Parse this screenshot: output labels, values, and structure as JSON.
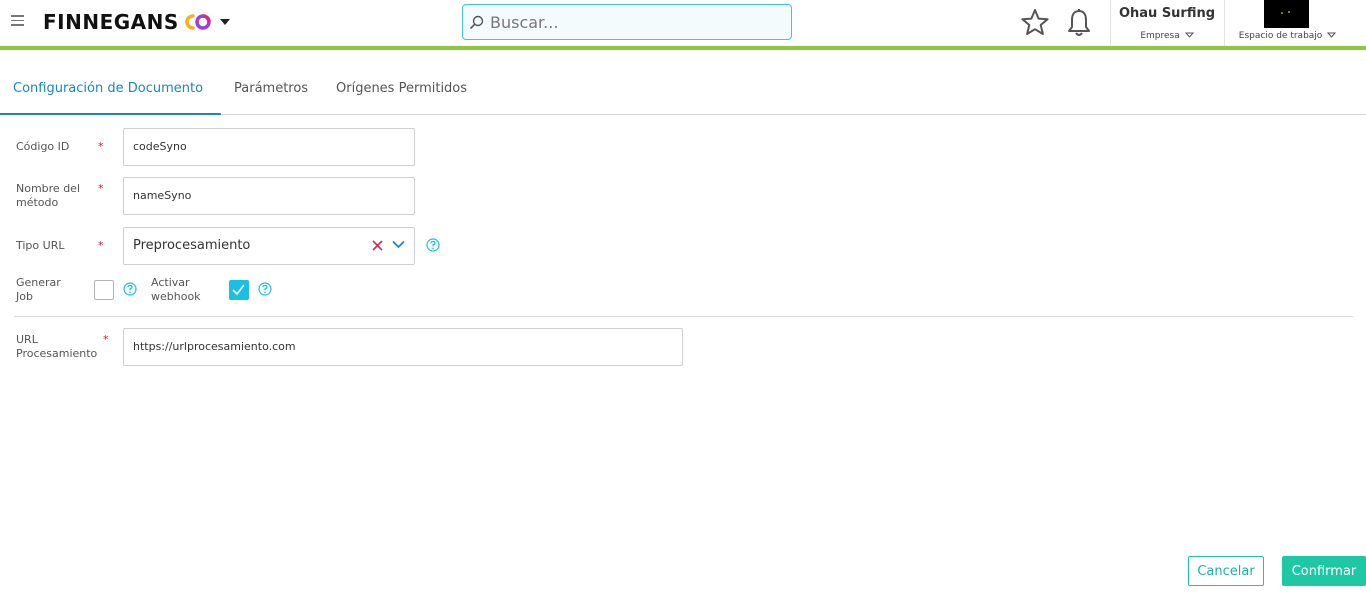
{
  "header": {
    "logo_text": "FINNEGANS",
    "search_placeholder": "Buscar...",
    "company_name": "Ohau Surfing",
    "company_label": "Empresa",
    "workspace_label": "Espacio de trabajo",
    "icons": [
      "menu-icon",
      "logo-mark-icon",
      "chevron-down-icon",
      "search-icon",
      "star-icon",
      "bell-icon"
    ],
    "colors": {
      "accent_line": "#8dc63f",
      "search_border": "#3fc7d6"
    }
  },
  "tabs": [
    {
      "label": "Configuración de Documento",
      "active": true
    },
    {
      "label": "Parámetros",
      "active": false
    },
    {
      "label": "Orígenes Permitidos",
      "active": false
    }
  ],
  "form": {
    "codigo_label": "Código ID",
    "codigo_value": "codeSyno",
    "nombre_label_1": "Nombre del",
    "nombre_label_2": "método",
    "nombre_value": "nameSyno",
    "tipo_label": "Tipo URL",
    "tipo_value": "Preprocesamiento",
    "generar_label_1": "Generar",
    "generar_label_2": "Job",
    "generar_checked": false,
    "webhook_label_1": "Activar",
    "webhook_label_2": "webhook",
    "webhook_checked": true,
    "url_label_1": "URL",
    "url_label_2": "Procesamiento",
    "url_value": "https://urlprocesamiento.com",
    "required_mark": "*"
  },
  "actions": {
    "cancel_label": "Cancelar",
    "confirm_label": "Confirmar",
    "accent": "#1ec8a5"
  }
}
